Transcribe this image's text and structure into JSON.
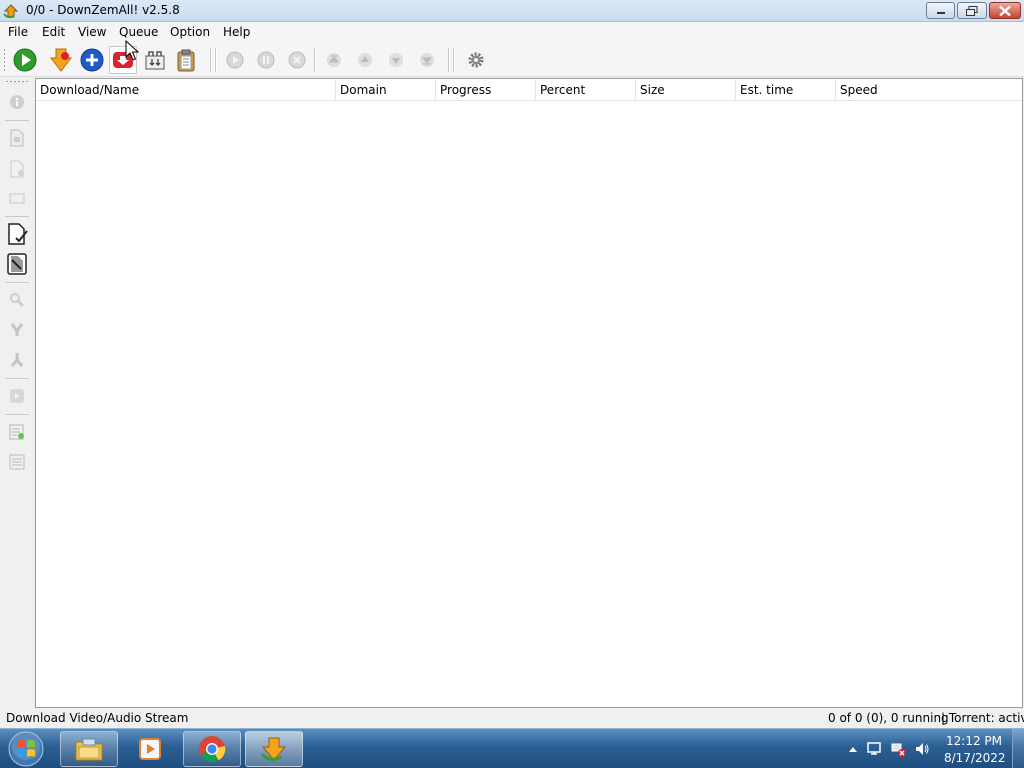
{
  "window": {
    "title": "0/0 - DownZemAll! v2.5.8"
  },
  "menu": {
    "items": [
      {
        "label": "File"
      },
      {
        "label": "Edit"
      },
      {
        "label": "View"
      },
      {
        "label": "Queue"
      },
      {
        "label": "Option"
      },
      {
        "label": "Help"
      }
    ]
  },
  "toolbar": {
    "buttons": [
      {
        "icon": "start-icon"
      },
      {
        "icon": "wizard-download-icon"
      },
      {
        "icon": "add-download-icon"
      },
      {
        "icon": "download-stream-icon",
        "state": "hovered"
      },
      {
        "icon": "add-torrent-icon"
      },
      {
        "icon": "paste-urls-icon"
      },
      {
        "icon": "resume-icon",
        "state": "disabled"
      },
      {
        "icon": "pause-icon",
        "state": "disabled"
      },
      {
        "icon": "cancel-icon",
        "state": "disabled"
      },
      {
        "icon": "move-top-icon",
        "state": "disabled"
      },
      {
        "icon": "move-up-icon",
        "state": "disabled"
      },
      {
        "icon": "move-down-icon",
        "state": "disabled"
      },
      {
        "icon": "move-bottom-icon",
        "state": "disabled"
      },
      {
        "icon": "settings-icon"
      }
    ]
  },
  "sidebar": {
    "buttons": [
      {
        "icon": "info-icon",
        "state": "disabled"
      },
      {
        "icon": "open-file-icon",
        "state": "disabled"
      },
      {
        "icon": "rename-file-icon",
        "state": "disabled"
      },
      {
        "icon": "open-directory-icon",
        "state": "disabled"
      },
      {
        "icon": "select-completed-icon"
      },
      {
        "icon": "invert-selection-icon"
      },
      {
        "icon": "find-icon",
        "state": "disabled"
      },
      {
        "icon": "check-icon",
        "state": "disabled"
      },
      {
        "icon": "merge-icon",
        "state": "disabled"
      },
      {
        "icon": "replay-icon",
        "state": "disabled"
      },
      {
        "icon": "add-list-icon",
        "state": "disabled"
      },
      {
        "icon": "remove-list-icon",
        "state": "disabled"
      }
    ]
  },
  "table": {
    "columns": [
      {
        "label": "Download/Name"
      },
      {
        "label": "Domain"
      },
      {
        "label": "Progress"
      },
      {
        "label": "Percent"
      },
      {
        "label": "Size"
      },
      {
        "label": "Est. time"
      },
      {
        "label": "Speed"
      }
    ],
    "rows": []
  },
  "status": {
    "message": "Download Video/Audio Stream",
    "count": "0 of 0 (0), 0 running",
    "torrent": "| Torrent: active"
  },
  "taskbar": {
    "apps": [
      {
        "icon": "explorer-icon"
      },
      {
        "icon": "media-player-icon"
      },
      {
        "icon": "chrome-icon"
      },
      {
        "icon": "downzemall-icon",
        "state": "active"
      }
    ],
    "clock": {
      "time": "12:12 PM",
      "date": "8/17/2022"
    }
  }
}
